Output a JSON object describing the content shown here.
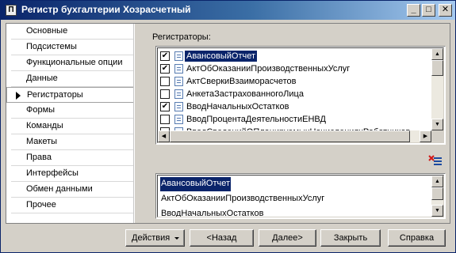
{
  "window": {
    "title": "Регистр бухгалтерии Хозрасчетный",
    "app_icon_glyph": "П",
    "minimize_glyph": "_",
    "maximize_glyph": "□",
    "close_glyph": "✕"
  },
  "nav": {
    "items": [
      {
        "label": "Основные"
      },
      {
        "label": "Подсистемы"
      },
      {
        "label": "Функциональные опции"
      },
      {
        "label": "Данные"
      },
      {
        "label": "Регистраторы"
      },
      {
        "label": "Формы"
      },
      {
        "label": "Команды"
      },
      {
        "label": "Макеты"
      },
      {
        "label": "Права"
      },
      {
        "label": "Интерфейсы"
      },
      {
        "label": "Обмен данными"
      },
      {
        "label": "Прочее"
      }
    ],
    "active": "Регистраторы"
  },
  "registrators": {
    "label": "Регистраторы:",
    "items": [
      {
        "label": "АвансовыйОтчет",
        "checked": true,
        "selected": true
      },
      {
        "label": "АктОбОказанииПроизводственныхУслуг",
        "checked": true,
        "selected": false
      },
      {
        "label": "АктСверкиВзаиморасчетов",
        "checked": false,
        "selected": false
      },
      {
        "label": "АнкетаЗастрахованногоЛица",
        "checked": false,
        "selected": false
      },
      {
        "label": "ВводНачальныхОстатков",
        "checked": true,
        "selected": false
      },
      {
        "label": "ВводПроцентаДеятельностиЕНВД",
        "checked": false,
        "selected": false
      },
      {
        "label": "ВводСведенийОПланируемыхНачисленияхРаботников",
        "checked": false,
        "selected": false
      }
    ]
  },
  "selected_list": {
    "items": [
      {
        "label": "АвансовыйОтчет",
        "selected": true
      },
      {
        "label": "АктОбОказанииПроизводственныхУслуг",
        "selected": false
      },
      {
        "label": "ВводНачальныхОстатков",
        "selected": false
      }
    ]
  },
  "scroll_glyphs": {
    "up": "▲",
    "down": "▼",
    "left": "◀",
    "right": "▶"
  },
  "check_glyph": "✔",
  "buttons": {
    "actions": "Действия",
    "back": "<Назад",
    "next": "Далее>",
    "close": "Закрыть",
    "help": "Справка"
  }
}
